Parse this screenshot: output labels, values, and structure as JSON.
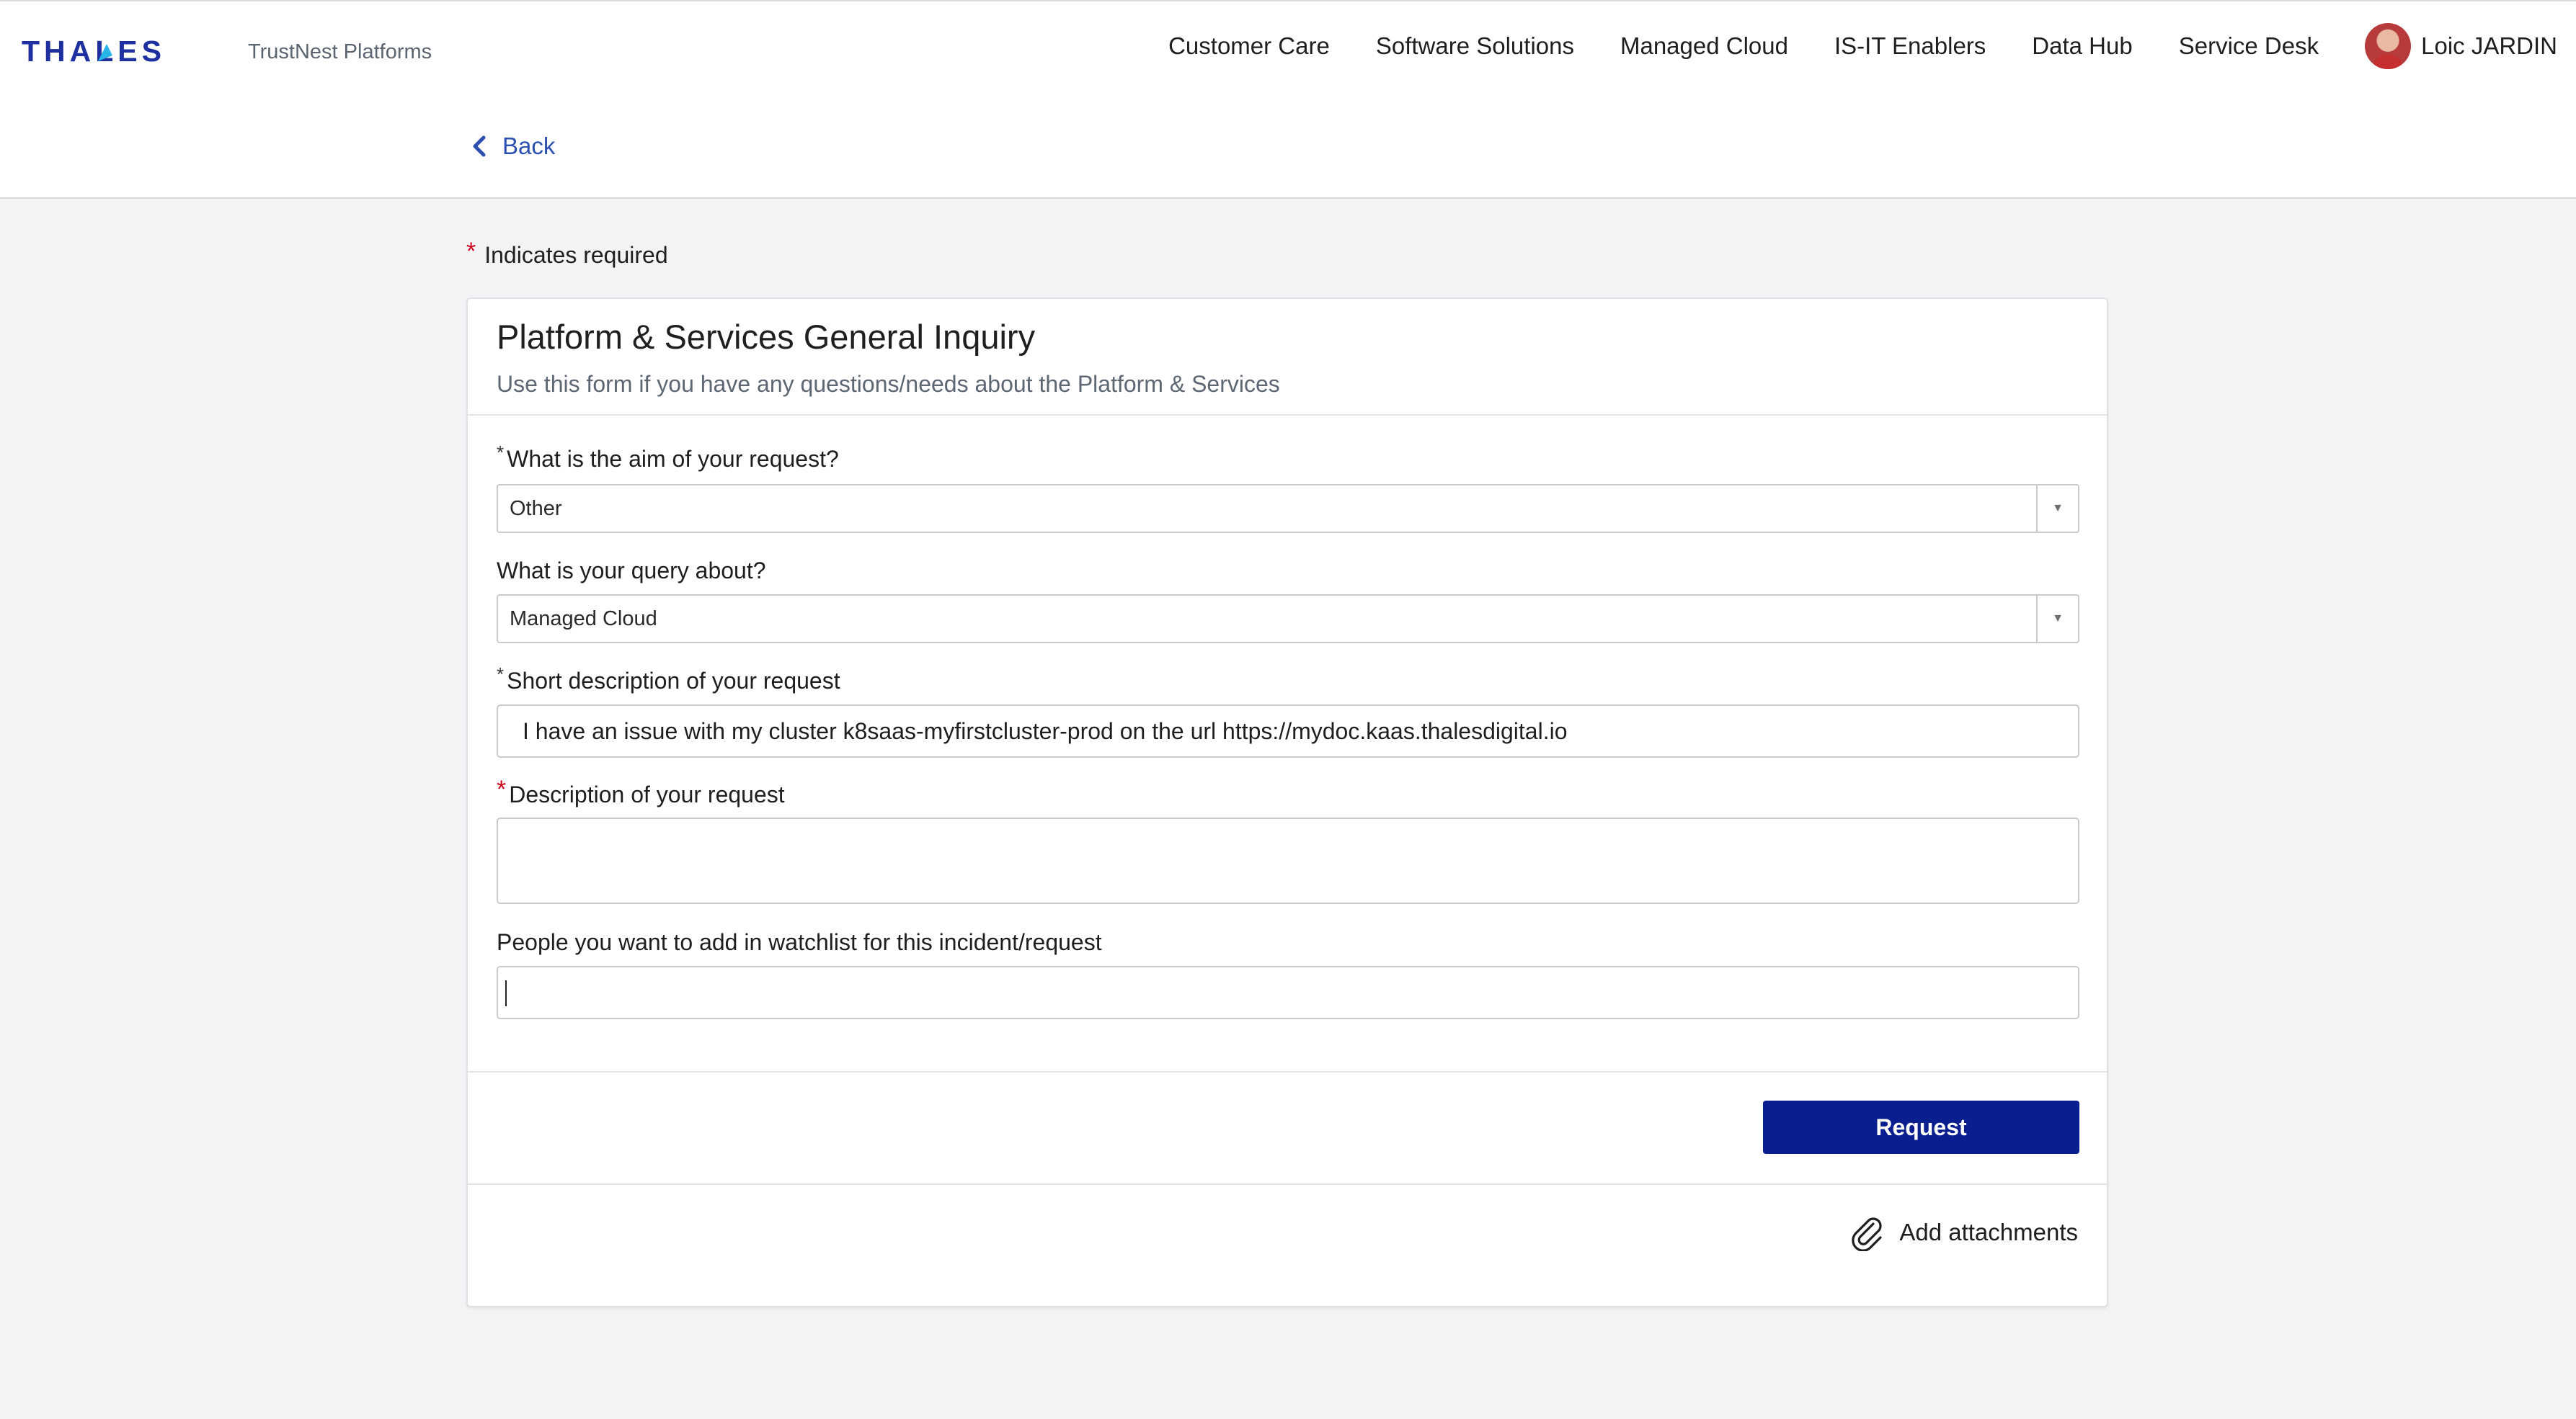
{
  "header": {
    "brand": "THALES",
    "platform_name": "TrustNest Platforms",
    "nav": [
      {
        "label": "Customer Care"
      },
      {
        "label": "Software Solutions"
      },
      {
        "label": "Managed Cloud"
      },
      {
        "label": "IS-IT Enablers"
      },
      {
        "label": "Data Hub"
      },
      {
        "label": "Service Desk"
      }
    ],
    "user_name": "Loic JARDIN",
    "back_label": "Back"
  },
  "required_note": "Indicates required",
  "form": {
    "title": "Platform & Services General Inquiry",
    "subtitle": "Use this form if you have any questions/needs about the Platform & Services",
    "fields": {
      "aim": {
        "label": "What is the aim of your request?",
        "value": "Other"
      },
      "query_about": {
        "label": "What is your query about?",
        "value": "Managed Cloud"
      },
      "short_description": {
        "label": "Short description of your request",
        "value": "I have an issue with my cluster k8saas-myfirstcluster-prod on the url https://mydoc.kaas.thalesdigital.io"
      },
      "description": {
        "label": "Description of your request",
        "value": ""
      },
      "watchlist": {
        "label": "People you want to add in watchlist for this incident/request",
        "value": ""
      }
    },
    "submit_label": "Request",
    "attachments_label": "Add attachments"
  },
  "colors": {
    "brand_navy": "#0a1f8f",
    "link_blue": "#2d4fb0",
    "required_red": "#d0021b",
    "page_background": "#f2f3f5"
  }
}
